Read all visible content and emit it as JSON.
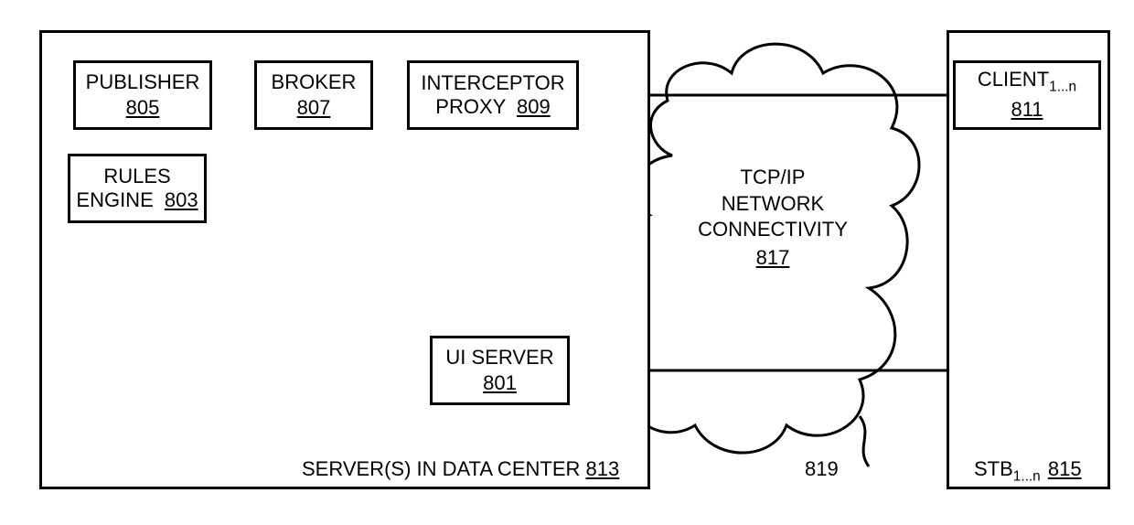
{
  "datacenter": {
    "label_prefix": "SERVER(S) IN DATA CENTER",
    "ref": "813"
  },
  "publisher": {
    "label": "PUBLISHER",
    "ref": "805"
  },
  "broker": {
    "label": "BROKER",
    "ref": "807"
  },
  "interceptor": {
    "label1": "INTERCEPTOR",
    "label2": "PROXY",
    "ref": "809"
  },
  "rules": {
    "label1": "RULES",
    "label2": "ENGINE",
    "ref": "803"
  },
  "uiserver": {
    "label": "UI SERVER",
    "ref": "801"
  },
  "client": {
    "label_prefix": "CLIENT",
    "label_sub": "1...n",
    "ref": "811"
  },
  "stb": {
    "label_prefix": "STB",
    "label_sub": "1...n",
    "ref": "815"
  },
  "cloud": {
    "label1": "TCP/IP",
    "label2": "NETWORK",
    "label3": "CONNECTIVITY",
    "ref": "817"
  },
  "wave_ref": "819"
}
